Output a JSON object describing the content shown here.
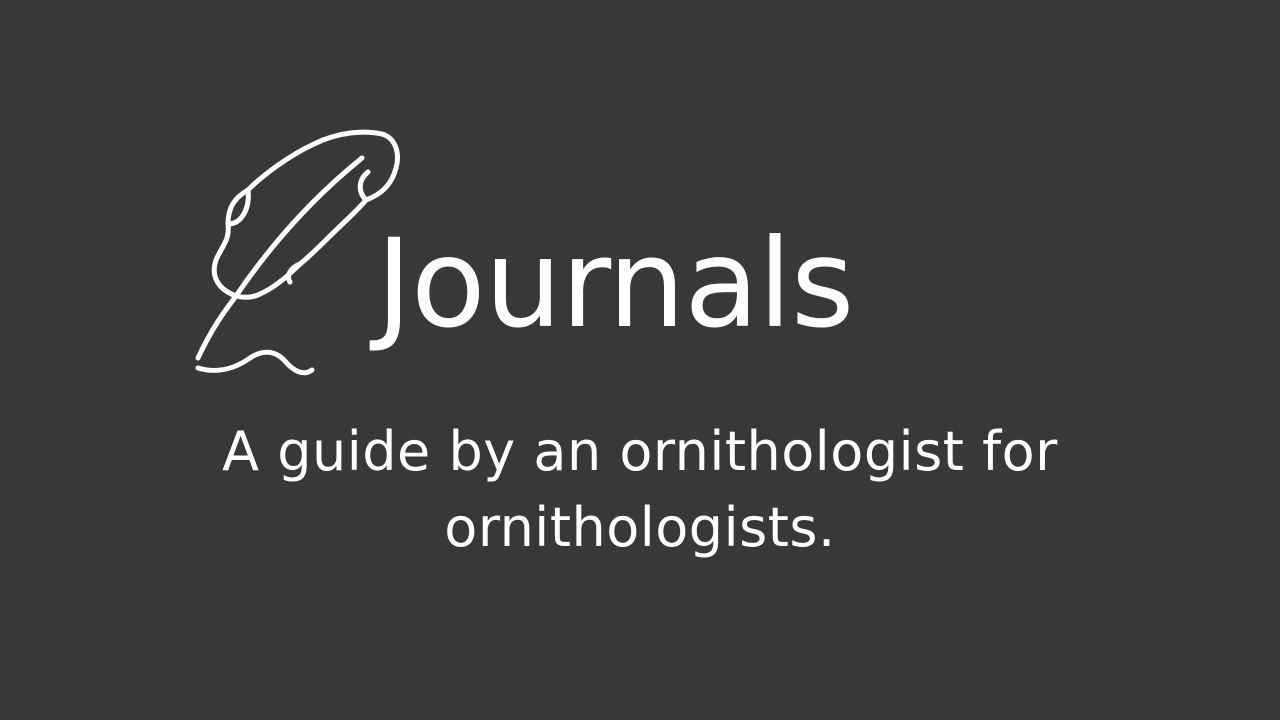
{
  "slide": {
    "title": "Journals",
    "subtitle": "A guide by an ornithologist for ornithologists.",
    "icon": "quill-pen-icon",
    "colors": {
      "background": "#3a3837",
      "foreground": "#ffffff"
    }
  }
}
